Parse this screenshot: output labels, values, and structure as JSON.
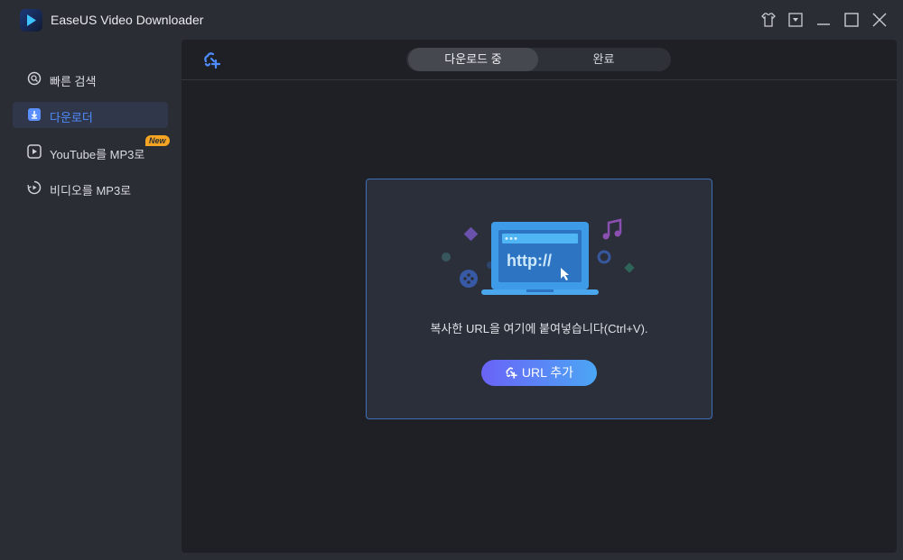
{
  "app": {
    "title": "EaseUS Video Downloader"
  },
  "window_controls": [
    "skin-icon",
    "menu-icon",
    "minimize-icon",
    "maximize-icon",
    "close-icon"
  ],
  "sidebar": {
    "items": [
      {
        "label": "빠른 검색",
        "icon": "search-icon",
        "active": false
      },
      {
        "label": "다운로더",
        "icon": "downloader-icon",
        "active": true
      },
      {
        "label": "YouTube를 MP3로",
        "icon": "youtube-play-icon",
        "active": false,
        "badge": "New"
      },
      {
        "label": "비디오를 MP3로",
        "icon": "video-convert-icon",
        "active": false
      }
    ]
  },
  "main": {
    "tabs": [
      {
        "label": "다운로드 중",
        "active": true
      },
      {
        "label": "완료",
        "active": false
      }
    ],
    "drop_card": {
      "illustration_text": "http://",
      "hint": "복사한 URL을 여기에 붙여넣습니다(Ctrl+V).",
      "button_label": "URL 추가"
    }
  },
  "colors": {
    "accent": "#4f8cff",
    "badge": "#f5a523",
    "card_border": "#3f6fb8",
    "button_gradient_start": "#6a63f6",
    "button_gradient_end": "#4ba6f5"
  }
}
